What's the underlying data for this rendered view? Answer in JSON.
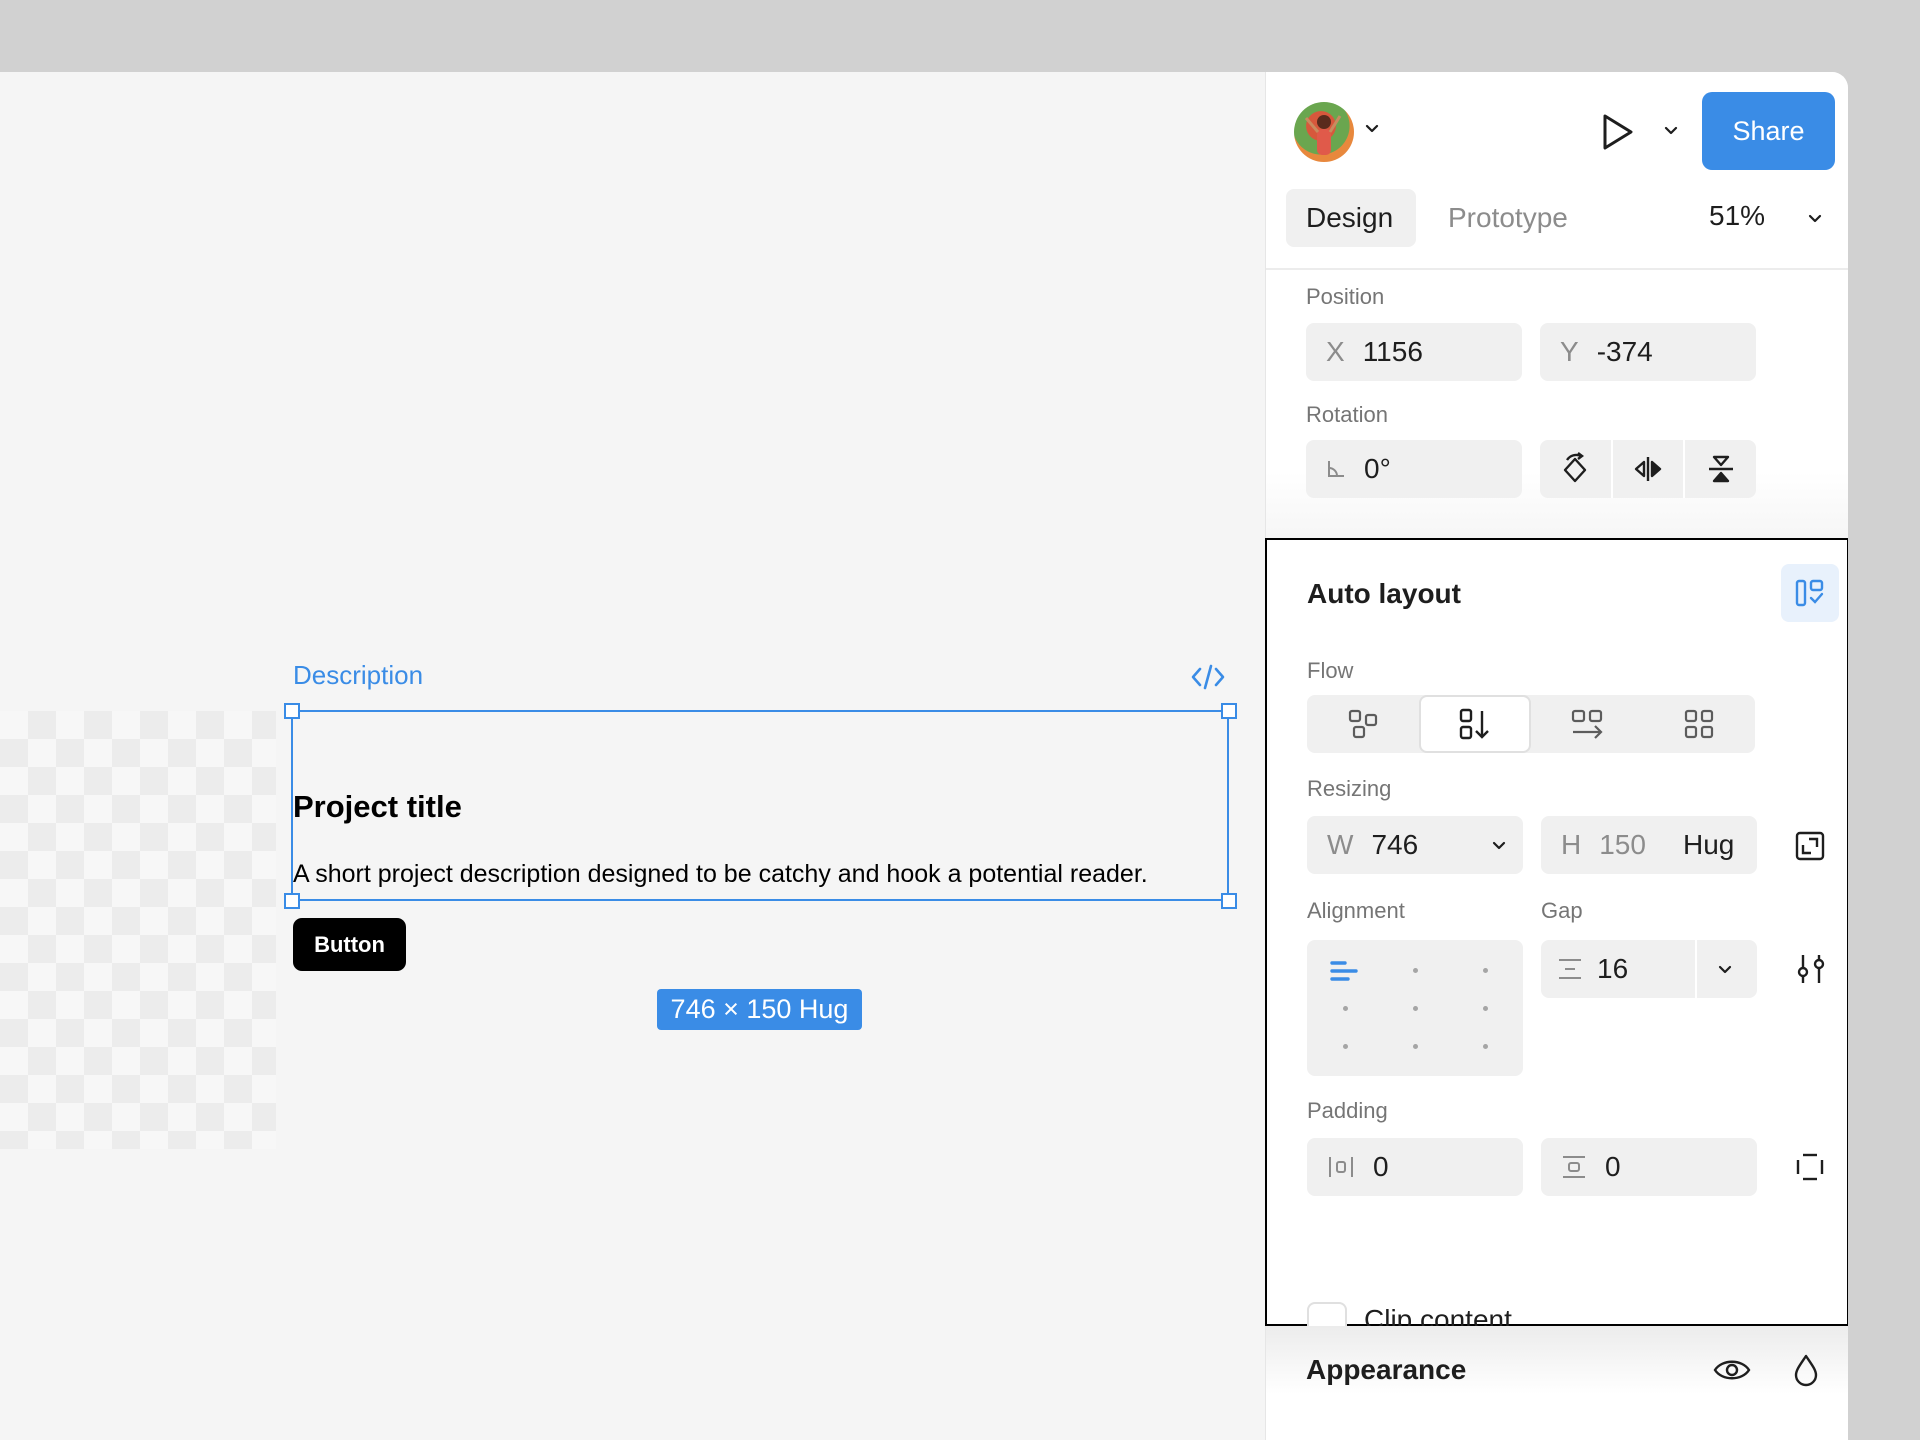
{
  "toolbar": {
    "share_label": "Share",
    "tabs": {
      "design": "Design",
      "prototype": "Prototype"
    },
    "zoom": "51%"
  },
  "canvas": {
    "frame_label": "Description",
    "project_title": "Project title",
    "project_description": "A short project description designed to be catchy and hook a potential reader.",
    "button_label": "Button",
    "size_badge": "746 × 150 Hug"
  },
  "position": {
    "label": "Position",
    "x_prefix": "X",
    "x_value": "1156",
    "y_prefix": "Y",
    "y_value": "-374"
  },
  "rotation": {
    "label": "Rotation",
    "value": "0°"
  },
  "auto_layout": {
    "title": "Auto layout",
    "flow_label": "Flow",
    "resizing_label": "Resizing",
    "width_prefix": "W",
    "width_value": "746",
    "height_prefix": "H",
    "height_value": "150",
    "height_mode": "Hug",
    "alignment_label": "Alignment",
    "gap_label": "Gap",
    "gap_value": "16",
    "padding_label": "Padding",
    "padding_horizontal": "0",
    "padding_vertical": "0",
    "clip_content_label": "Clip content"
  },
  "appearance": {
    "title": "Appearance"
  },
  "colors": {
    "accent": "#3a8ce6",
    "panel_bg": "#ffffff",
    "canvas_bg": "#f5f5f5",
    "field_bg": "#f0f0f0"
  }
}
